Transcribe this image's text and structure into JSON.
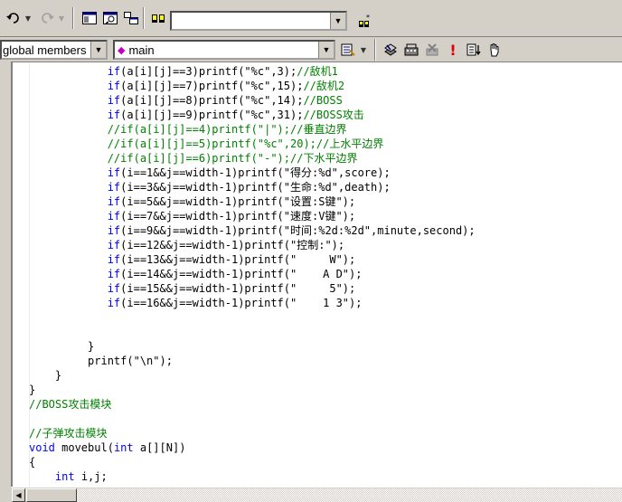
{
  "toolbar1": {
    "icons": [
      "undo-icon",
      "redo-icon",
      "workspace-icon",
      "find-in-files-icon",
      "output-window-icon",
      "browse-icon",
      "find-icon"
    ],
    "find_value": ""
  },
  "toolbar2": {
    "scope_value": "global members",
    "member_value": "main",
    "icons": [
      "compile-icon",
      "build-icon",
      "stop-build-icon",
      "build-execute-icon",
      "go-icon",
      "insert-breakpoint-icon"
    ]
  },
  "code_lines": [
    {
      "parts": [
        {
          "t": "            "
        },
        {
          "t": "if",
          "c": "kw"
        },
        {
          "t": "(a[i][j]==3)printf(\"%c\",3);"
        },
        {
          "t": "//敌机1",
          "c": "cm"
        }
      ]
    },
    {
      "parts": [
        {
          "t": "            "
        },
        {
          "t": "if",
          "c": "kw"
        },
        {
          "t": "(a[i][j]==7)printf(\"%c\",15);"
        },
        {
          "t": "//敌机2",
          "c": "cm"
        }
      ]
    },
    {
      "parts": [
        {
          "t": "            "
        },
        {
          "t": "if",
          "c": "kw"
        },
        {
          "t": "(a[i][j]==8)printf(\"%c\",14);"
        },
        {
          "t": "//BOSS",
          "c": "cm"
        }
      ]
    },
    {
      "parts": [
        {
          "t": "            "
        },
        {
          "t": "if",
          "c": "kw"
        },
        {
          "t": "(a[i][j]==9)printf(\"%c\",31);"
        },
        {
          "t": "//BOSS攻击",
          "c": "cm"
        }
      ]
    },
    {
      "parts": [
        {
          "t": "            "
        },
        {
          "t": "//if(a[i][j]==4)printf(\"|\");//垂直边界",
          "c": "cm"
        }
      ]
    },
    {
      "parts": [
        {
          "t": "            "
        },
        {
          "t": "//if(a[i][j]==5)printf(\"%c\",20);//上水平边界",
          "c": "cm"
        }
      ]
    },
    {
      "parts": [
        {
          "t": "            "
        },
        {
          "t": "//if(a[i][j]==6)printf(\"-\");//下水平边界",
          "c": "cm"
        }
      ]
    },
    {
      "parts": [
        {
          "t": "            "
        },
        {
          "t": "if",
          "c": "kw"
        },
        {
          "t": "(i==1&&j==width-1)printf(\"得分:%d\",score);"
        }
      ]
    },
    {
      "parts": [
        {
          "t": "            "
        },
        {
          "t": "if",
          "c": "kw"
        },
        {
          "t": "(i==3&&j==width-1)printf(\"生命:%d\",death);"
        }
      ]
    },
    {
      "parts": [
        {
          "t": "            "
        },
        {
          "t": "if",
          "c": "kw"
        },
        {
          "t": "(i==5&&j==width-1)printf(\"设置:S键\");"
        }
      ]
    },
    {
      "parts": [
        {
          "t": "            "
        },
        {
          "t": "if",
          "c": "kw"
        },
        {
          "t": "(i==7&&j==width-1)printf(\"速度:V键\");"
        }
      ]
    },
    {
      "parts": [
        {
          "t": "            "
        },
        {
          "t": "if",
          "c": "kw"
        },
        {
          "t": "(i==9&&j==width-1)printf(\"时间:%2d:%2d\",minute,second);"
        }
      ]
    },
    {
      "parts": [
        {
          "t": "            "
        },
        {
          "t": "if",
          "c": "kw"
        },
        {
          "t": "(i==12&&j==width-1)printf(\"控制:\");"
        }
      ]
    },
    {
      "parts": [
        {
          "t": "            "
        },
        {
          "t": "if",
          "c": "kw"
        },
        {
          "t": "(i==13&&j==width-1)printf(\"     W\");"
        }
      ]
    },
    {
      "parts": [
        {
          "t": "            "
        },
        {
          "t": "if",
          "c": "kw"
        },
        {
          "t": "(i==14&&j==width-1)printf(\"    A D\");"
        }
      ]
    },
    {
      "parts": [
        {
          "t": "            "
        },
        {
          "t": "if",
          "c": "kw"
        },
        {
          "t": "(i==15&&j==width-1)printf(\"     5\");"
        }
      ]
    },
    {
      "parts": [
        {
          "t": "            "
        },
        {
          "t": "if",
          "c": "kw"
        },
        {
          "t": "(i==16&&j==width-1)printf(\"    1 3\");"
        }
      ]
    },
    {
      "parts": [
        {
          "t": ""
        }
      ]
    },
    {
      "parts": [
        {
          "t": ""
        }
      ]
    },
    {
      "parts": [
        {
          "t": "         }"
        }
      ]
    },
    {
      "parts": [
        {
          "t": "         printf(\"\\n\");"
        }
      ]
    },
    {
      "parts": [
        {
          "t": "    }"
        }
      ]
    },
    {
      "parts": [
        {
          "t": "}"
        }
      ]
    },
    {
      "parts": [
        {
          "t": "//BOSS攻击模块",
          "c": "cm"
        }
      ]
    },
    {
      "parts": [
        {
          "t": ""
        }
      ]
    },
    {
      "parts": [
        {
          "t": "//子弹攻击模块",
          "c": "cm"
        }
      ]
    },
    {
      "parts": [
        {
          "t": "void",
          "c": "kw"
        },
        {
          "t": " movebul("
        },
        {
          "t": "int",
          "c": "kw"
        },
        {
          "t": " a[][N])"
        }
      ]
    },
    {
      "parts": [
        {
          "t": "{"
        }
      ]
    },
    {
      "parts": [
        {
          "t": "    "
        },
        {
          "t": "int",
          "c": "kw"
        },
        {
          "t": " i,j;"
        }
      ]
    }
  ],
  "colors": {
    "keyword": "#0000ff",
    "comment": "#008000",
    "text": "#000000"
  }
}
